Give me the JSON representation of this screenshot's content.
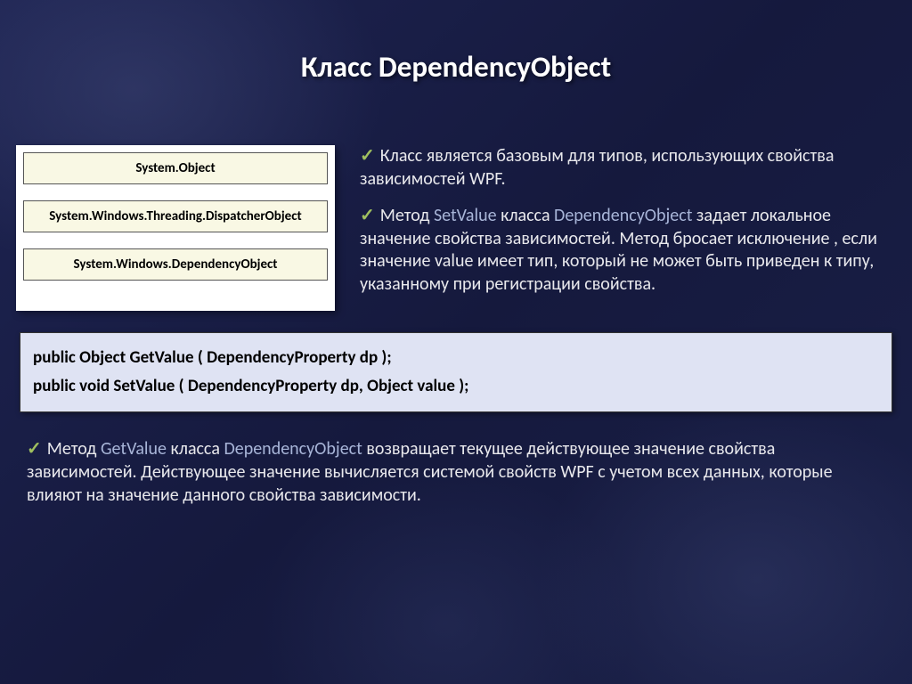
{
  "title": "Класс DependencyObject",
  "diagram": {
    "box1": "System.Object",
    "box2": "System.Windows.Threading.DispatcherObject",
    "box3": "System.Windows.DependencyObject"
  },
  "bullets": {
    "b1": "Класс является базовым для типов, использующих свойства зависимостей WPF.",
    "b2_pre": "Метод ",
    "b2_m": "SetValue",
    "b2_mid": " класса ",
    "b2_cls": "DependencyObject",
    "b2_post": " задает локальное значение свойства зависимостей. Метод бросает исключение , если значение value имеет тип, который не может быть приведен к типу, указанному при регистрации свойства."
  },
  "code": {
    "line1": "public Object GetValue ( DependencyProperty dp );",
    "line2": "public void SetValue ( DependencyProperty dp, Object value );"
  },
  "bottom": {
    "pre": "Метод ",
    "m": "GetValue",
    "mid": " класса ",
    "cls": "DependencyObject",
    "post": " возвращает текущее действующее значение свойства зависимостей. Действующее значение вычисляется системой свойств WPF с учетом всех данных, которые влияют на значение данного свойства зависимости."
  }
}
